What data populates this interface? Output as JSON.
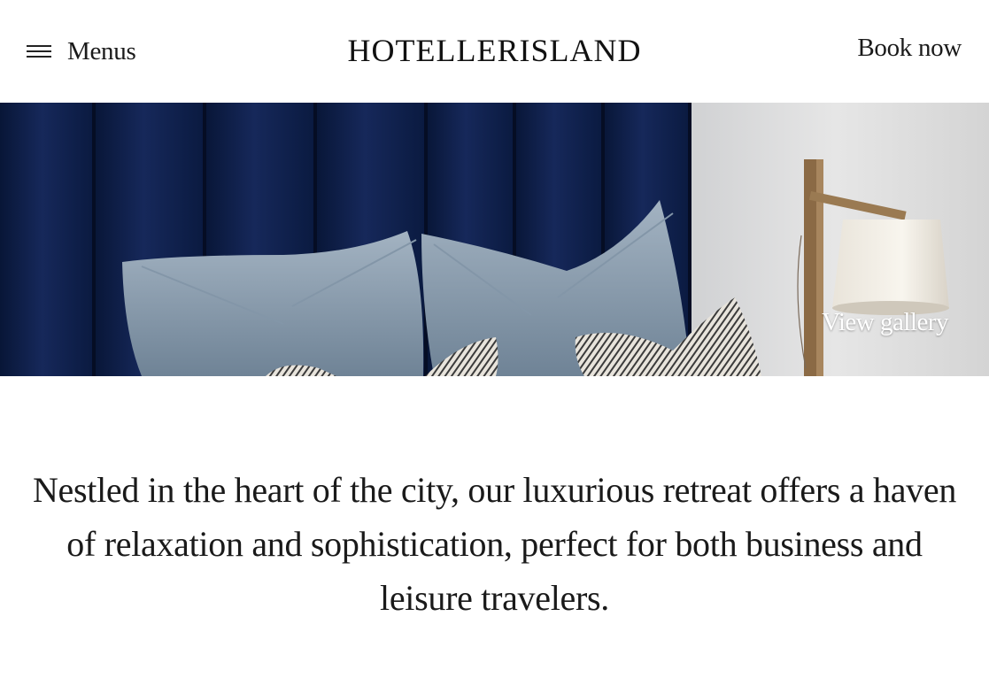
{
  "header": {
    "menu_label": "Menus",
    "logo": "HOTELLERISLAND",
    "book_label": "Book now"
  },
  "hero": {
    "gallery_label": "View gallery"
  },
  "intro": {
    "text": "Nestled in the heart of the city, our luxurious retreat offers a haven of relaxation and sophistication, perfect for both business and leisure travelers."
  },
  "colors": {
    "headboard": "#0e1e44",
    "pillow": "#8fa2b3",
    "wall": "#dcdcdc",
    "text": "#1a1a1a"
  }
}
